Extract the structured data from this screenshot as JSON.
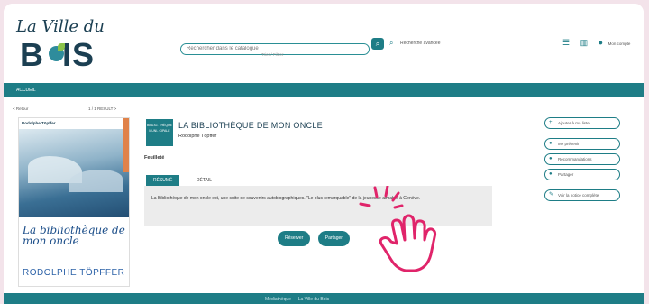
{
  "header": {
    "logo": {
      "line1": "La Ville du",
      "line2": "B",
      "line3": "IS"
    },
    "search": {
      "placeholder": "Rechercher dans le catalogue",
      "hint": "Trier / Filtrer",
      "advanced_label": "Recherche avancée"
    },
    "icons": [
      "menu-icon",
      "books-icon",
      "account-icon"
    ],
    "account_label": "Mon compte"
  },
  "nav": {
    "home": "ACCUEIL"
  },
  "record": {
    "pager_prev": "< Retour",
    "pager_next": "1 / 1 RESULT >",
    "thumb_label": "BIBLIO- THÈQUE MUNI- CIPALE",
    "title": "LA BIBLIOTHÈQUE DE MON ONCLE",
    "author": "Rodolphe Töpffer",
    "type": "Feuilleté",
    "tabs": [
      "RÉSUMÉ",
      "DÉTAIL"
    ],
    "summary": "La Bibliothèque de mon oncle est, une suite de souvenirs autobiographiques. \"Le plus remarquable\" de la jeunesse aimable à Genève.",
    "actions": [
      "Réserver",
      "Partager"
    ]
  },
  "cover": {
    "tag": "Rodolphe Töpffer",
    "title": "La bibliothèque de mon oncle",
    "author": "RODOLPHE TÖPFFER"
  },
  "side_actions": [
    {
      "icon": "plus-icon",
      "label": "Ajouter à ma liste"
    },
    {
      "icon": "bell-icon",
      "label": "Me prévenir"
    },
    {
      "icon": "star-icon",
      "label": "Recommandations"
    },
    {
      "icon": "share-icon",
      "label": "Partager"
    },
    {
      "icon": "info-icon",
      "label": "Voir la notice complète"
    }
  ],
  "footer": {
    "text": "Médiathèque — La Ville du Bois"
  },
  "colors": {
    "teal": "#1e7d86",
    "navy": "#1b3f52",
    "pink_bg": "#f3e3ea",
    "hand": "#e0246a"
  }
}
